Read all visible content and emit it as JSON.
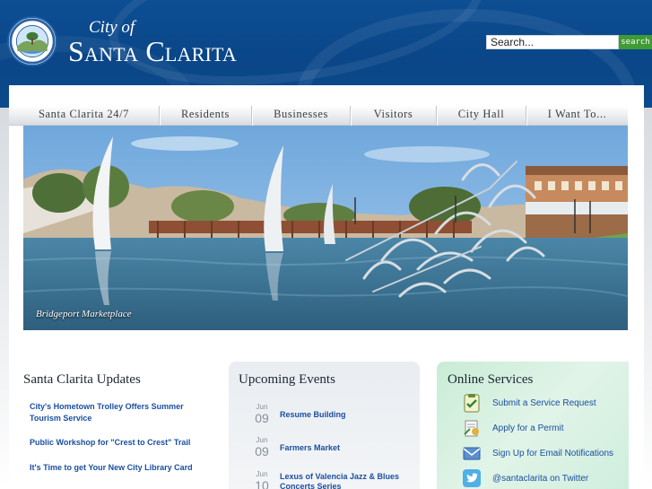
{
  "header": {
    "title_small": "City of",
    "title_big": "Santa Clarita",
    "search_placeholder": "Search...",
    "search_button": "search",
    "logo_icon": "city-seal-icon"
  },
  "nav": {
    "items": [
      {
        "label": "Santa Clarita 24/7"
      },
      {
        "label": "Residents"
      },
      {
        "label": "Businesses"
      },
      {
        "label": "Visitors"
      },
      {
        "label": "City Hall"
      },
      {
        "label": "I Want To..."
      }
    ]
  },
  "hero": {
    "caption": "Bridgeport Marketplace"
  },
  "updates": {
    "title": "Santa Clarita Updates",
    "items": [
      {
        "label": "City's Hometown Trolley Offers Summer Tourism Service"
      },
      {
        "label": "Public Workshop for \"Crest to Crest\" Trail"
      },
      {
        "label": "It's Time to get Your New City Library Card"
      }
    ]
  },
  "events": {
    "title": "Upcoming Events",
    "items": [
      {
        "month": "Jun",
        "day": "09",
        "label": "Resume Building"
      },
      {
        "month": "Jun",
        "day": "09",
        "label": "Farmers Market"
      },
      {
        "month": "Jun",
        "day": "10",
        "label": "Lexus of Valencia Jazz & Blues Concerts Series"
      }
    ]
  },
  "online_services": {
    "title": "Online Services",
    "items": [
      {
        "label": "Submit a Service Request",
        "icon": "clipboard-check-icon"
      },
      {
        "label": "Apply for a Permit",
        "icon": "permit-document-icon"
      },
      {
        "label": "Sign Up for Email Notifications",
        "icon": "envelope-icon"
      },
      {
        "label": "@santaclarita on Twitter",
        "icon": "twitter-bird-icon"
      }
    ]
  },
  "colors": {
    "header_blue": "#0b4a8c",
    "search_green": "#3f9b34",
    "link_blue": "#1b4fa0",
    "services_green": "#d4efdf"
  }
}
